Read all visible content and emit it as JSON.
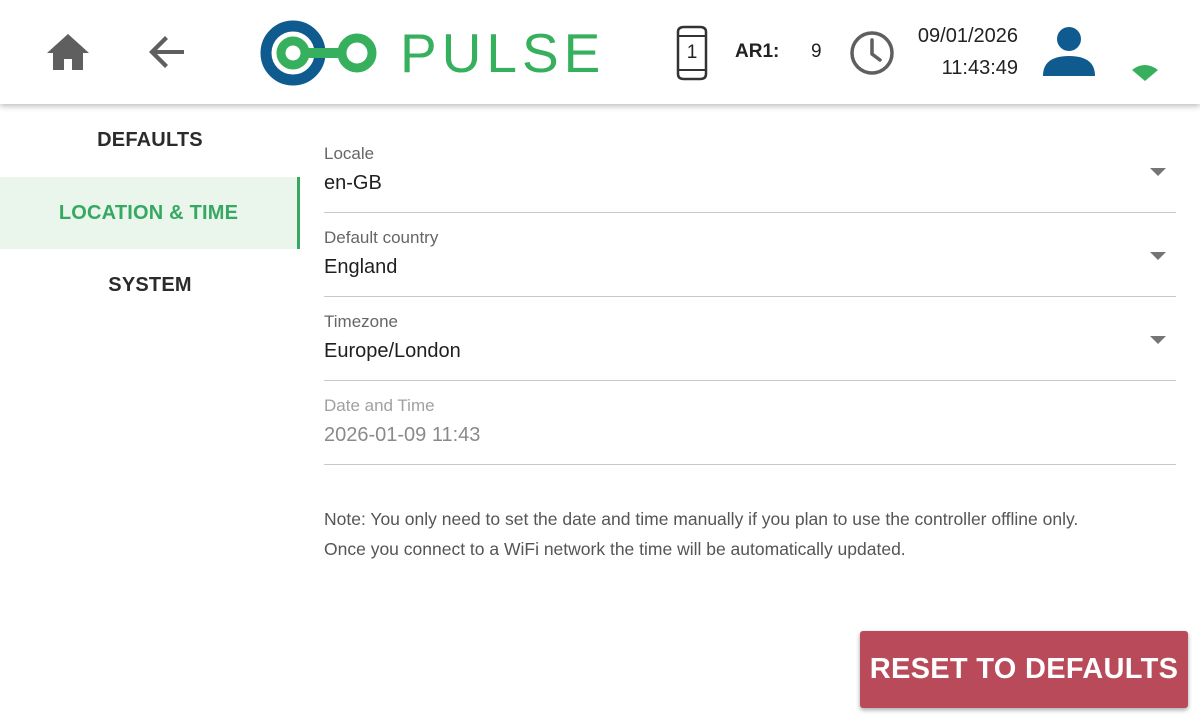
{
  "header": {
    "home_icon": "home-icon",
    "back_icon": "arrow-back-icon",
    "logo_text": "PULSE",
    "device_count": "1",
    "ar_label": "AR1:",
    "ar_value": "9",
    "clock_icon": "clock-icon",
    "date": "09/01/2026",
    "time": "11:43:49",
    "user_icon": "user-icon",
    "wifi_icon": "wifi-icon"
  },
  "sidebar": {
    "items": [
      {
        "label": "DEFAULTS",
        "active": false
      },
      {
        "label": "LOCATION & TIME",
        "active": true
      },
      {
        "label": "SYSTEM",
        "active": false
      }
    ]
  },
  "form": {
    "locale": {
      "label": "Locale",
      "value": "en-GB"
    },
    "country": {
      "label": "Default country",
      "value": "England"
    },
    "timezone": {
      "label": "Timezone",
      "value": "Europe/London"
    },
    "datetime": {
      "label": "Date and Time",
      "value": "2026-01-09 11:43",
      "disabled": true
    }
  },
  "note": {
    "line1": "Note: You only need to set the date and time manually if you plan to use the controller offline only.",
    "line2": "Once you connect to a WiFi network the time will be automatically updated."
  },
  "reset_button": {
    "label": "RESET TO DEFAULTS"
  },
  "colors": {
    "brand_green": "#37b05e",
    "brand_blue": "#0f5b8f",
    "active_bg": "#eaf5ec",
    "reset_red": "#b84a59",
    "icon_gray": "#5f5f5f"
  }
}
